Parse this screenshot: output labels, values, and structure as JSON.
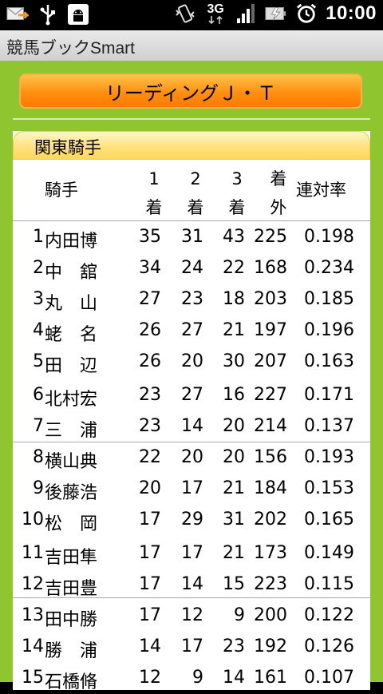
{
  "status_bar": {
    "icons_left": [
      "mail-icon",
      "usb-icon",
      "android-debug-icon"
    ],
    "icons_right": [
      "vibrate-icon",
      "network-3g-icon",
      "signal-icon",
      "battery-charging-icon",
      "alarm-icon"
    ],
    "network": "3G",
    "time": "10:00"
  },
  "app": {
    "title": "競馬ブックSmart"
  },
  "header_button": {
    "label": "リーディングＪ・Ｔ"
  },
  "section": {
    "title": "関東騎手"
  },
  "table": {
    "headers": {
      "jockey": "騎手",
      "first": [
        "1",
        "着"
      ],
      "second": [
        "2",
        "着"
      ],
      "third": [
        "3",
        "着"
      ],
      "other": [
        "着",
        "外"
      ],
      "rate": "連対率"
    },
    "rows": [
      {
        "rank": "1",
        "name": "内田博",
        "first": "35",
        "second": "31",
        "third": "43",
        "other": "225",
        "rate": "0.198"
      },
      {
        "rank": "2",
        "name": "中　舘",
        "first": "34",
        "second": "24",
        "third": "22",
        "other": "168",
        "rate": "0.234"
      },
      {
        "rank": "3",
        "name": "丸　山",
        "first": "27",
        "second": "23",
        "third": "18",
        "other": "203",
        "rate": "0.185"
      },
      {
        "rank": "4",
        "name": "蛯　名",
        "first": "26",
        "second": "27",
        "third": "21",
        "other": "197",
        "rate": "0.196"
      },
      {
        "rank": "5",
        "name": "田　辺",
        "first": "26",
        "second": "20",
        "third": "30",
        "other": "207",
        "rate": "0.163"
      },
      {
        "rank": "6",
        "name": "北村宏",
        "first": "23",
        "second": "27",
        "third": "16",
        "other": "227",
        "rate": "0.171"
      },
      {
        "rank": "7",
        "name": "三　浦",
        "first": "23",
        "second": "14",
        "third": "20",
        "other": "214",
        "rate": "0.137"
      },
      {
        "rank": "8",
        "name": "横山典",
        "first": "22",
        "second": "20",
        "third": "20",
        "other": "156",
        "rate": "0.193"
      },
      {
        "rank": "9",
        "name": "後藤浩",
        "first": "20",
        "second": "17",
        "third": "21",
        "other": "184",
        "rate": "0.153"
      },
      {
        "rank": "10",
        "name": "松　岡",
        "first": "17",
        "second": "29",
        "third": "31",
        "other": "202",
        "rate": "0.165"
      },
      {
        "rank": "11",
        "name": "吉田隼",
        "first": "17",
        "second": "17",
        "third": "21",
        "other": "173",
        "rate": "0.149"
      },
      {
        "rank": "12",
        "name": "吉田豊",
        "first": "17",
        "second": "14",
        "third": "15",
        "other": "223",
        "rate": "0.115"
      },
      {
        "rank": "13",
        "name": "田中勝",
        "first": "17",
        "second": "12",
        "third": "9",
        "other": "200",
        "rate": "0.122"
      },
      {
        "rank": "14",
        "name": "勝　浦",
        "first": "14",
        "second": "17",
        "third": "23",
        "other": "192",
        "rate": "0.126"
      },
      {
        "rank": "15",
        "name": "石橋脩",
        "first": "12",
        "second": "9",
        "third": "14",
        "other": "161",
        "rate": "0.107"
      }
    ]
  },
  "colors": {
    "background": "#8fc52f",
    "header_button": "#ff8f10",
    "section_tab": "#ffe07a"
  }
}
